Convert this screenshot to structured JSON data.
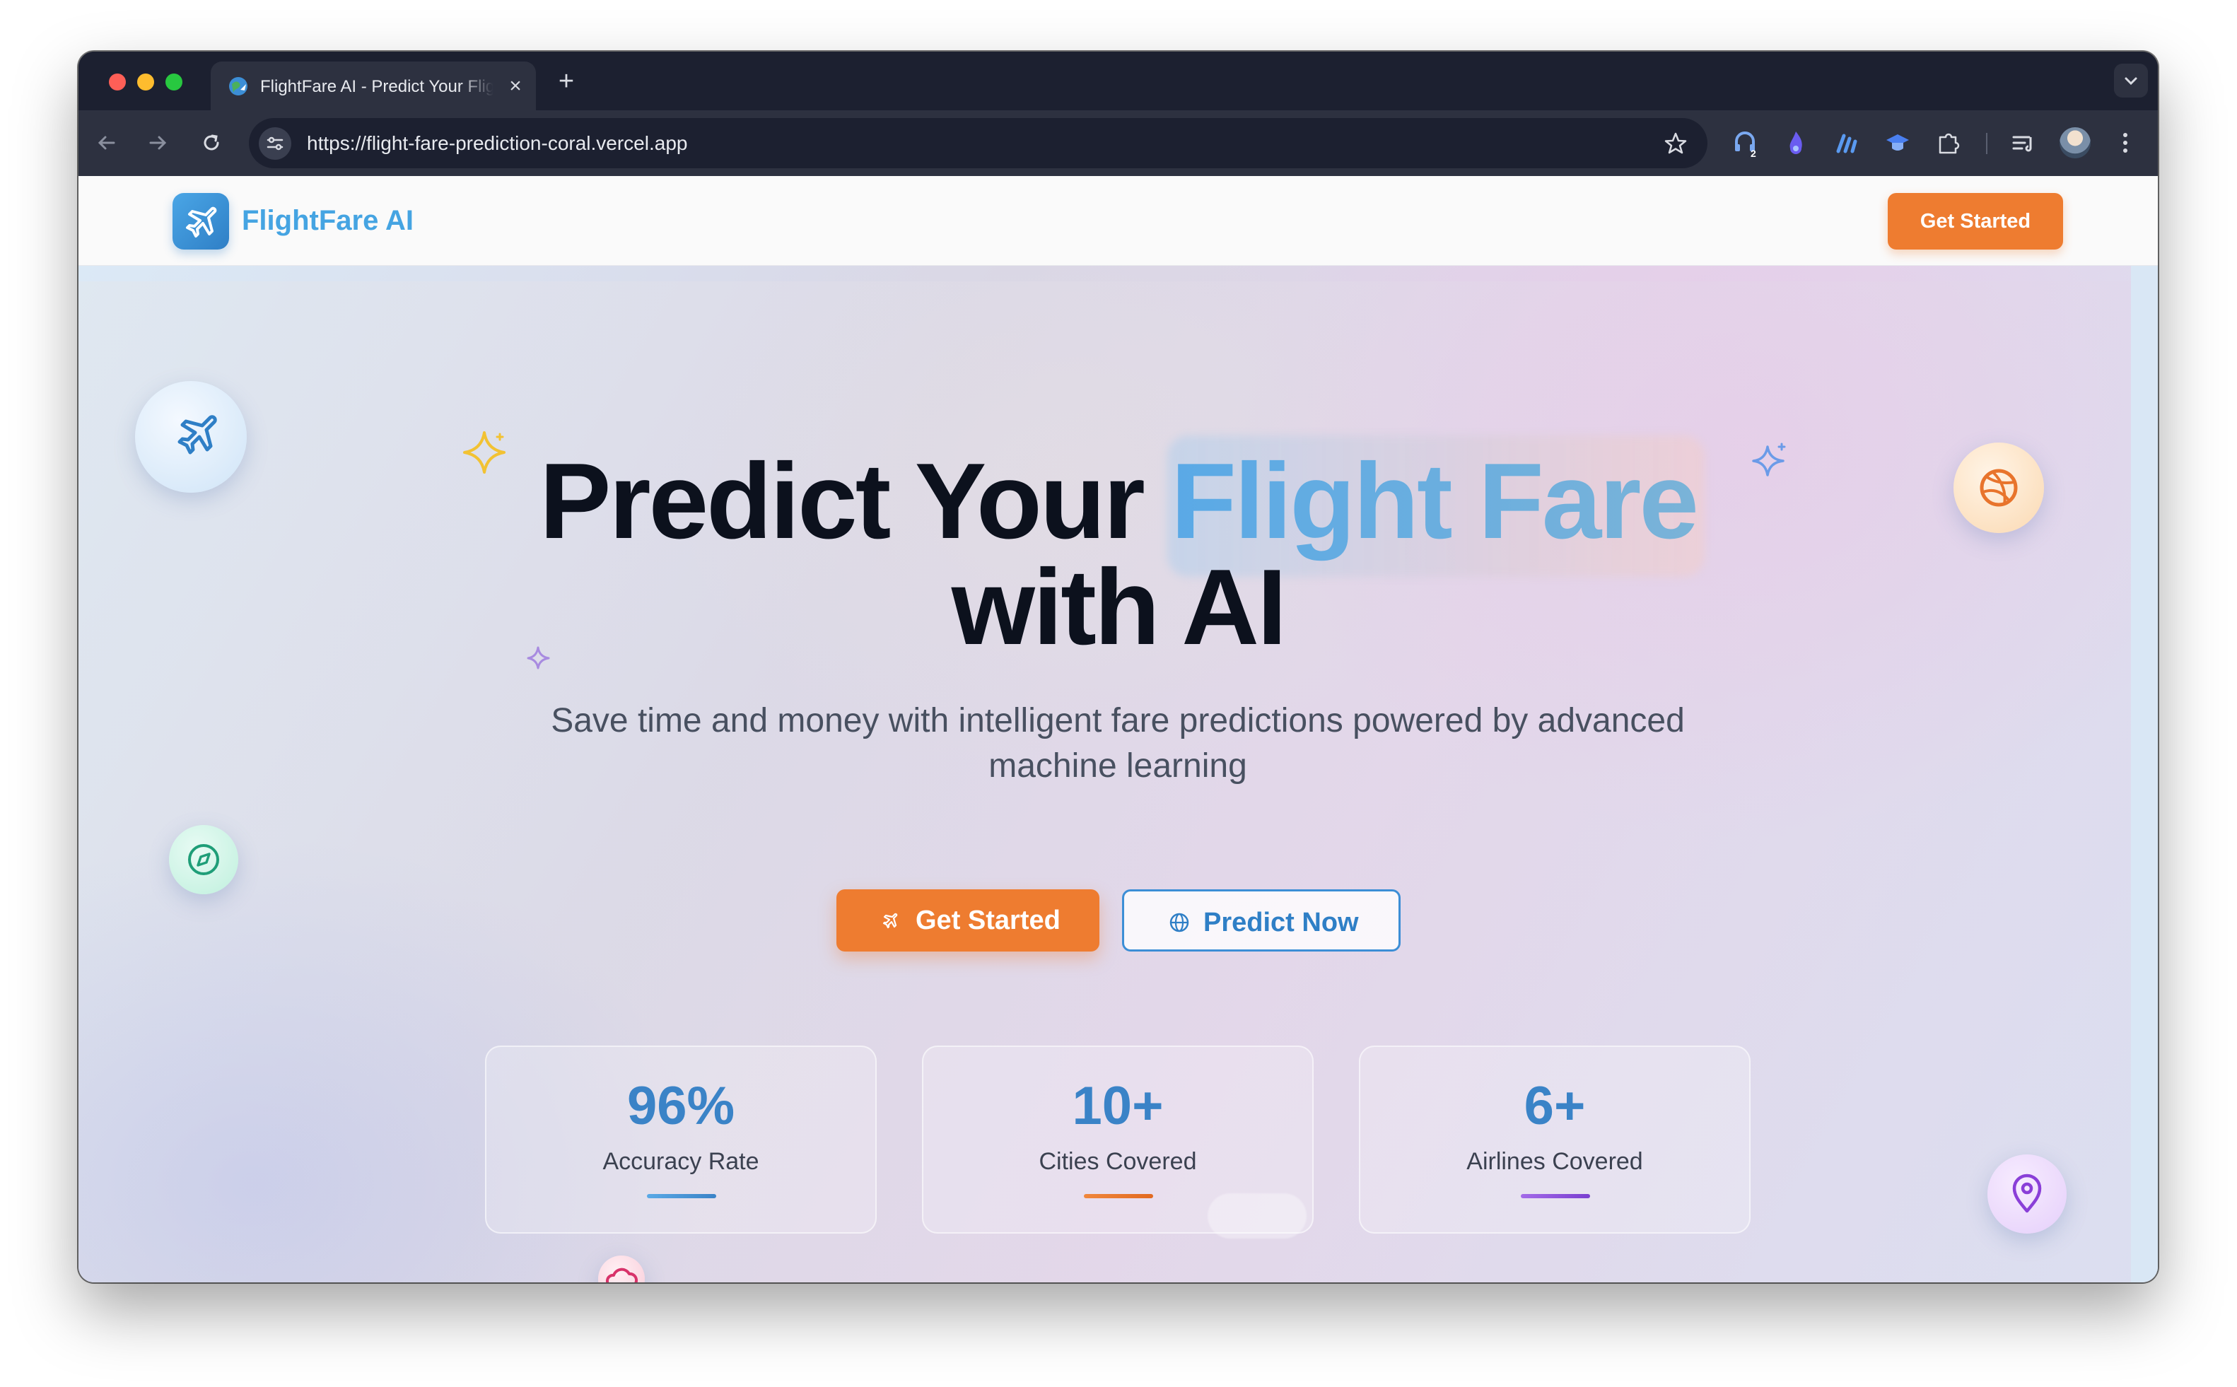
{
  "browser": {
    "tab": {
      "title": "FlightFare AI - Predict Your Flight Fare",
      "close_glyph": "×"
    },
    "new_tab_glyph": "+",
    "url": "https://flight-fare-prediction-coral.vercel.app",
    "extension_badge": "2"
  },
  "site": {
    "logo_text": "FlightFare AI",
    "header_cta": "Get Started"
  },
  "hero": {
    "title_part1": "Predict Your ",
    "title_highlight": "Flight Fare",
    "title_part2": "with AI",
    "subtitle": "Save time and money with intelligent fare predictions powered by advanced machine learning",
    "primary_button": "Get Started",
    "secondary_button": "Predict Now"
  },
  "stats": [
    {
      "value": "96%",
      "label": "Accuracy Rate",
      "accent": "#3a8bd6"
    },
    {
      "value": "10+",
      "label": "Cities Covered",
      "accent": "#e8742c"
    },
    {
      "value": "6+",
      "label": "Airlines Covered",
      "accent": "#8a4fd8"
    }
  ],
  "colors": {
    "brand_blue": "#45a4e2",
    "cta_orange": "#ee7c30",
    "title_dark": "#0c111d"
  }
}
